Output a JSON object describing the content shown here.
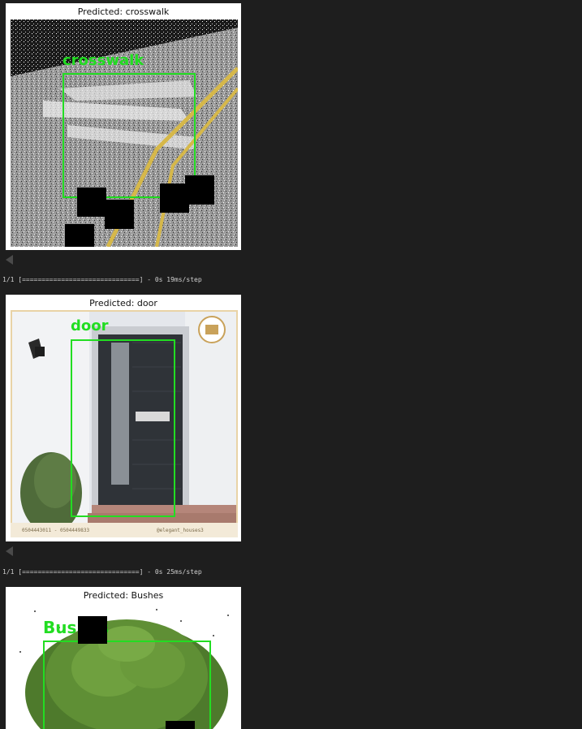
{
  "outputs": [
    {
      "title": "Predicted: crosswalk",
      "box_label": "crosswalk"
    },
    {
      "title": "Predicted: door",
      "box_label": "door",
      "footer_left": "0504443011 - 0504449833",
      "footer_right": "@elegant_houses3"
    },
    {
      "title": "Predicted: Bushes",
      "box_label": "Bushes"
    }
  ],
  "progress_lines": [
    "1/1 [==============================] - 0s 19ms/step",
    "1/1 [==============================] - 0s 25ms/step"
  ],
  "colors": {
    "background": "#1e1e1e",
    "bbox": "#22dd22"
  },
  "icons": {
    "scroll": "scroll-left-icon"
  }
}
